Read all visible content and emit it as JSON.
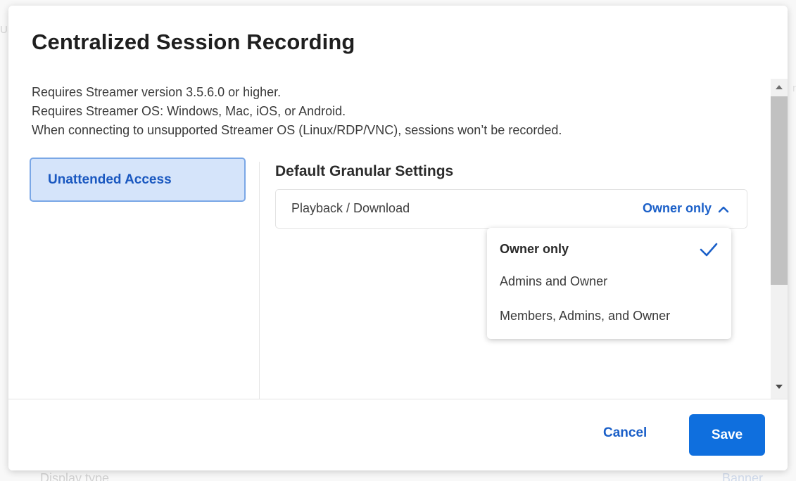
{
  "background": {
    "left_fragment": "Ur",
    "right_fragment": "r",
    "display_type_label": "Display type",
    "display_type_value": "Banner"
  },
  "modal": {
    "title": "Centralized Session Recording",
    "notes": [
      "Requires Streamer version 3.5.6.0 or higher.",
      "Requires Streamer OS: Windows, Mac, iOS, or Android.",
      "When connecting to unsupported Streamer OS (Linux/RDP/VNC), sessions won’t be recorded."
    ],
    "tabs": [
      {
        "label": "Unattended Access",
        "active": true
      }
    ],
    "section_title": "Default Granular Settings",
    "setting": {
      "label": "Playback / Download",
      "value": "Owner only",
      "expanded": true
    },
    "dropdown_options": [
      {
        "label": "Owner only",
        "selected": true
      },
      {
        "label": "Admins and Owner",
        "selected": false
      },
      {
        "label": "Members, Admins, and Owner",
        "selected": false
      }
    ],
    "footer": {
      "cancel_label": "Cancel",
      "save_label": "Save"
    }
  },
  "icons": {
    "chevron": "chevron-up-icon",
    "check": "checkmark-icon",
    "scroll_up": "scroll-up-arrow-icon",
    "scroll_down": "scroll-down-arrow-icon"
  },
  "colors": {
    "accent": "#1a5fc8",
    "primary_button": "#0f6fde",
    "active_tab_bg": "#d5e4fa",
    "active_tab_border": "#7aa7e6"
  }
}
